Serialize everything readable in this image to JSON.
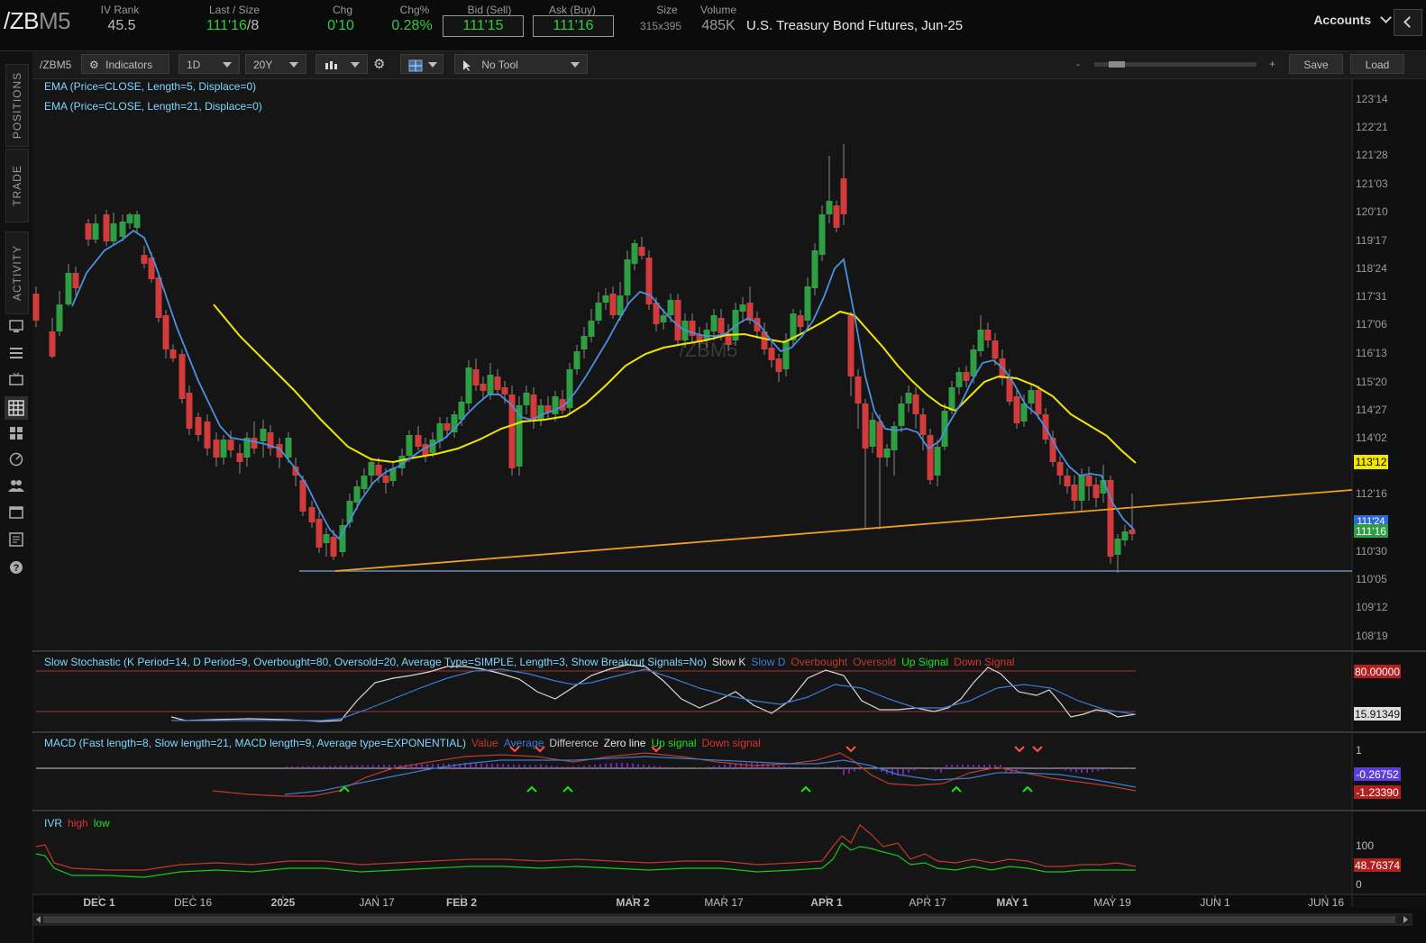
{
  "quote": {
    "symbol_main": "/ZB",
    "symbol_suffix": "M5",
    "iv_rank_label": "IV Rank",
    "iv_rank": "45.5",
    "last_label": "Last / Size",
    "last": "111'16",
    "last_size": "/8",
    "chg_label": "Chg",
    "chg": "0'10",
    "chgpct_label": "Chg%",
    "chgpct": "0.28%",
    "bid_label": "Bid (Sell)",
    "bid": "111'15",
    "ask_label": "Ask (Buy)",
    "ask": "111'16",
    "size_label": "Size",
    "size": "315x395",
    "volume_label": "Volume",
    "volume": "485K",
    "description": "U.S. Treasury Bond Futures, Jun-25",
    "accounts": "Accounts"
  },
  "rail": {
    "tabs": [
      "POSITIONS",
      "TRADE",
      "ACTIVITY"
    ],
    "icons": [
      "monitor-icon",
      "list-icon",
      "tv-icon",
      "chart-icon",
      "grid-icon",
      "gauge-icon",
      "people-icon",
      "calendar-icon",
      "news-icon",
      "help-icon"
    ]
  },
  "toolbar": {
    "symbol": "/ZBM5",
    "indicators": "Indicators",
    "period": "1D",
    "range": "20Y",
    "tool": "No Tool",
    "zoom_minus": "-",
    "zoom_plus": "+",
    "save": "Save",
    "load": "Load"
  },
  "main_chart": {
    "ema5_label": "EMA (Price=CLOSE, Length=5, Displace=0)",
    "ema21_label": "EMA (Price=CLOSE, Length=21, Displace=0)",
    "watermark": "/ZBM5",
    "price_ticks": [
      "123'14",
      "122'21",
      "121'28",
      "121'03",
      "120'10",
      "119'17",
      "118'24",
      "117'31",
      "117'06",
      "116'13",
      "115'20",
      "114'27",
      "114'02",
      "113'12",
      "112'16",
      "111'24",
      "111'16",
      "110'30",
      "110'05",
      "109'12",
      "108'19"
    ],
    "ema21_tag": "113'12",
    "ema5_tag": "111'24",
    "last_tag": "111'16",
    "colors": {
      "up": "#2e9e44",
      "down": "#d23b3b",
      "ema5": "#4a90e2",
      "ema21": "#f2e600",
      "trend": "#f0a020",
      "support": "#6f8fb0"
    }
  },
  "stochastic": {
    "label": "Slow Stochastic (K Period=14, D Period=9, Overbought=80, Oversold=20, Average Type=SIMPLE, Length=3, Show Breakout Signals=No)",
    "legend": [
      {
        "text": "Slow K",
        "color": "#e0e0e0"
      },
      {
        "text": "Slow D",
        "color": "#3a7bd5"
      },
      {
        "text": "Overbought",
        "color": "#c0392b"
      },
      {
        "text": "Oversold",
        "color": "#c0392b"
      },
      {
        "text": "Up Signal",
        "color": "#19e619"
      },
      {
        "text": "Down Signal",
        "color": "#e03030"
      }
    ],
    "tag_ob": "80.00000",
    "tag_val": "15.91349"
  },
  "macd": {
    "label": "MACD (Fast length=8, Slow length=21, MACD length=9, Average type=EXPONENTIAL)",
    "legend": [
      {
        "text": "Value",
        "color": "#c0392b"
      },
      {
        "text": "Average",
        "color": "#3a7bd5"
      },
      {
        "text": "Difference",
        "color": "#c9c9c9"
      },
      {
        "text": "Zero line",
        "color": "#e8e8e8"
      },
      {
        "text": "Up signal",
        "color": "#19e619"
      },
      {
        "text": "Down signal",
        "color": "#e03030"
      }
    ],
    "axis_label": "1",
    "tag_avg": "-0.26752",
    "tag_val": "-1.23390"
  },
  "ivr": {
    "label": "IVR",
    "legend": [
      {
        "text": "high",
        "color": "#e03030"
      },
      {
        "text": "low",
        "color": "#19e619"
      }
    ],
    "axis_100": "100",
    "axis_0": "0",
    "tag": "48.76374"
  },
  "time_axis": [
    "DEC 1",
    "DEC 16",
    "2025",
    "JAN 17",
    "FEB 2",
    "MAR 2",
    "MAR 17",
    "APR 1",
    "APR 17",
    "MAY 1",
    "MAY 19",
    "JUN 1",
    "JUN 16"
  ]
}
